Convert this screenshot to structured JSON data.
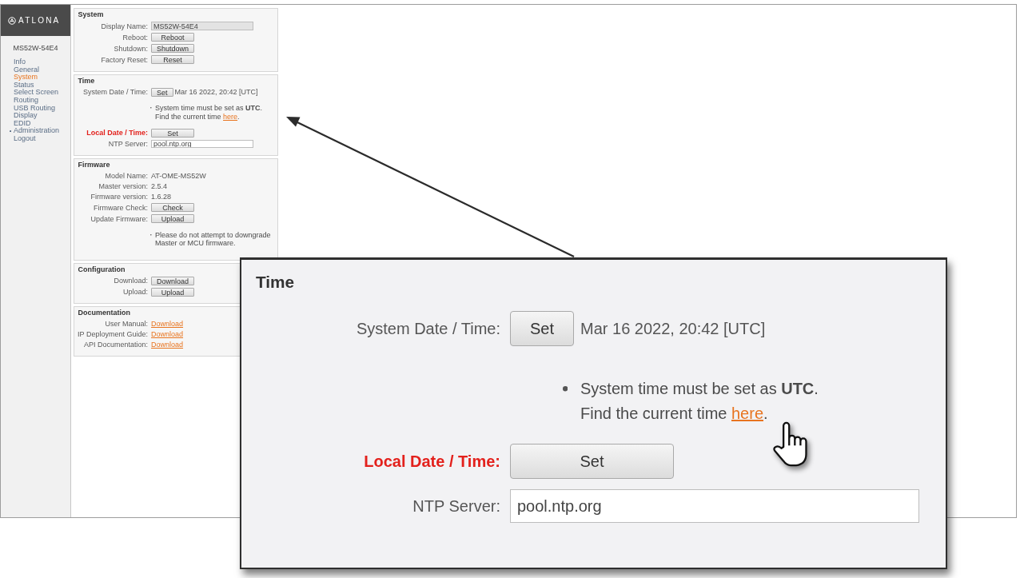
{
  "sidebar": {
    "logo": "ATLONA",
    "device_name": "MS52W-54E4",
    "items": [
      {
        "label": "Info",
        "kind": "link",
        "selected": false
      },
      {
        "label": "General",
        "kind": "link",
        "selected": false
      },
      {
        "label": "System",
        "kind": "link",
        "selected": true
      },
      {
        "label": "Status",
        "kind": "link",
        "selected": false
      },
      {
        "label": "Select Screen",
        "kind": "link",
        "selected": false
      },
      {
        "label": "Routing",
        "kind": "link",
        "selected": false
      },
      {
        "label": "USB Routing",
        "kind": "link",
        "selected": false
      },
      {
        "label": "Display",
        "kind": "link",
        "selected": false
      },
      {
        "label": "EDID",
        "kind": "link",
        "selected": false
      },
      {
        "label": "Administration",
        "kind": "group",
        "selected": false
      },
      {
        "label": "Logout",
        "kind": "link",
        "selected": false
      }
    ]
  },
  "sections": [
    {
      "title": "System",
      "rows": [
        {
          "kind": "field",
          "label": "Display Name:",
          "value": "MS52W-54E4",
          "disabled": true
        },
        {
          "kind": "button",
          "label": "Reboot:",
          "button": "Reboot"
        },
        {
          "kind": "button",
          "label": "Shutdown:",
          "button": "Shutdown"
        },
        {
          "kind": "button",
          "label": "Factory Reset:",
          "button": "Reset"
        }
      ]
    },
    {
      "title": "Time",
      "rows": [
        {
          "kind": "button_text",
          "label": "System Date / Time:",
          "button": "Set",
          "text": "Mar 16 2022, 20:42 [UTC]",
          "alert": false
        },
        {
          "kind": "note",
          "lines": [
            {
              "text": "System time must be set as **UTC**."
            },
            {
              "text": "Find the current time ",
              "link": "here",
              "after": "."
            }
          ]
        },
        {
          "kind": "button",
          "label": "Local Date / Time:",
          "button": "Set",
          "alert": true
        },
        {
          "kind": "field",
          "label": "NTP Server:",
          "value": "pool.ntp.org",
          "disabled": false,
          "alert": false
        }
      ]
    },
    {
      "title": "Firmware",
      "rows": [
        {
          "kind": "text",
          "label": "Model Name:",
          "text": "AT-OME-MS52W"
        },
        {
          "kind": "text",
          "label": "Master version:",
          "text": "2.5.4"
        },
        {
          "kind": "text",
          "label": "Firmware version:",
          "text": "1.6.28"
        },
        {
          "kind": "button",
          "label": "Firmware Check:",
          "button": "Check"
        },
        {
          "kind": "button",
          "label": "Update Firmware:",
          "button": "Upload"
        },
        {
          "kind": "note",
          "lines": [
            {
              "text": "Please do not attempt to downgrade"
            },
            {
              "text": "Master or MCU firmware."
            }
          ]
        }
      ]
    },
    {
      "title": "Configuration",
      "rows": [
        {
          "kind": "button",
          "label": "Download:",
          "button": "Download"
        },
        {
          "kind": "button",
          "label": "Upload:",
          "button": "Upload"
        }
      ]
    },
    {
      "title": "Documentation",
      "rows": [
        {
          "kind": "link",
          "label": "User Manual:",
          "link": "Download"
        },
        {
          "kind": "link",
          "label": "IP Deployment Guide:",
          "link": "Download"
        },
        {
          "kind": "link",
          "label": "API Documentation:",
          "link": "Download"
        }
      ]
    }
  ],
  "callout": {
    "title": "Time",
    "rows": [
      {
        "kind": "button_text",
        "label": "System Date / Time:",
        "button": "Set",
        "text": "Mar 16 2022, 20:42 [UTC]",
        "alert": false
      },
      {
        "kind": "note",
        "lines": [
          {
            "text": "System time must be set as **UTC**."
          },
          {
            "text": "Find the current time ",
            "link": "here",
            "after": "."
          }
        ]
      },
      {
        "kind": "button",
        "label": "Local Date / Time:",
        "button": "Set",
        "alert": true
      },
      {
        "kind": "field",
        "label": "NTP Server:",
        "value": "pool.ntp.org",
        "disabled": false,
        "alert": false
      }
    ]
  }
}
